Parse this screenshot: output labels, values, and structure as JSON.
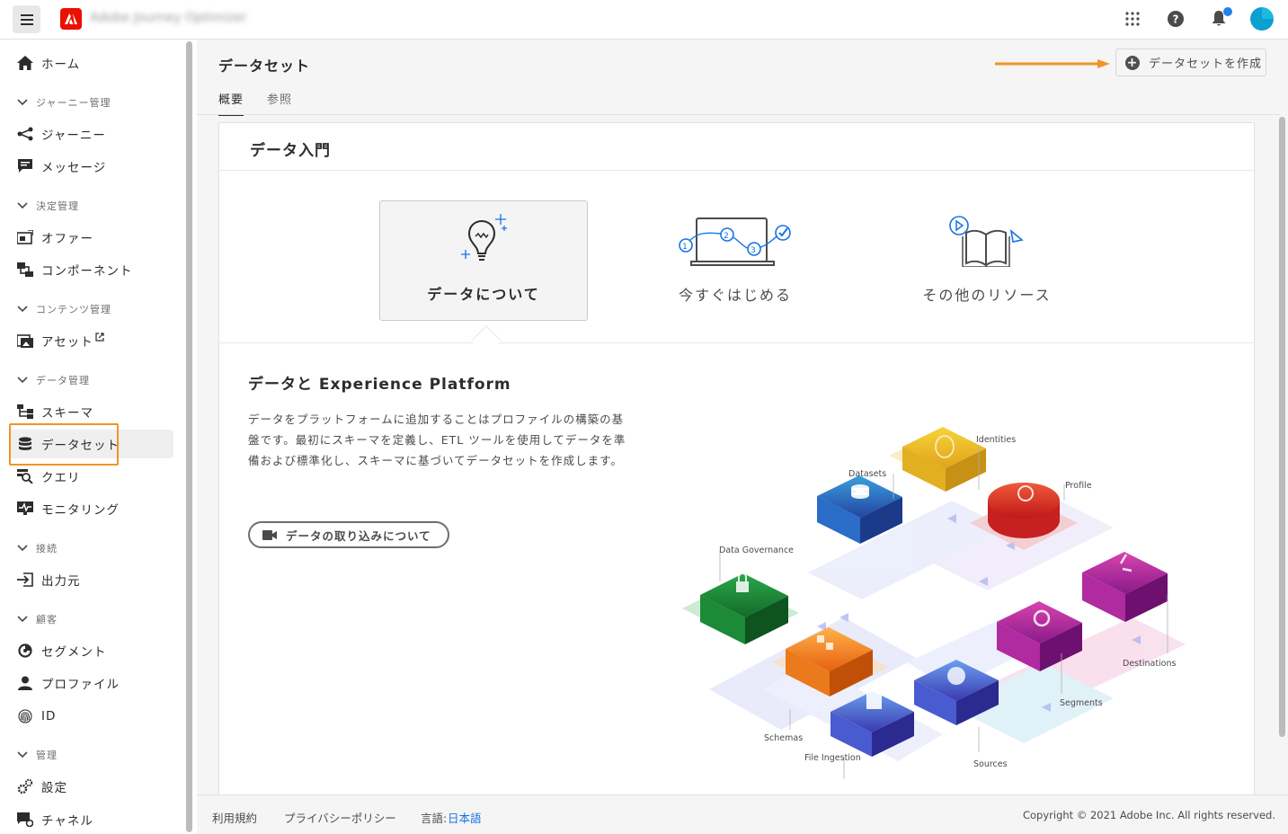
{
  "topbar": {
    "app_title": "Adobe Journey Optimizer"
  },
  "sidebar": {
    "home": "ホーム",
    "sections": [
      {
        "label": "ジャーニー管理"
      },
      {
        "label": "決定管理"
      },
      {
        "label": "コンテンツ管理"
      },
      {
        "label": "データ管理"
      },
      {
        "label": "接続"
      },
      {
        "label": "顧客"
      },
      {
        "label": "管理"
      }
    ],
    "items": {
      "journeys": "ジャーニー",
      "messages": "メッセージ",
      "offers": "オファー",
      "components": "コンポーネント",
      "assets": "アセット",
      "schemas": "スキーマ",
      "datasets": "データセット",
      "queries": "クエリ",
      "monitoring": "モニタリング",
      "sources": "出力元",
      "segments": "セグメント",
      "profiles": "プロファイル",
      "identities": "ID",
      "settings": "設定",
      "channels": "チャネル"
    }
  },
  "header": {
    "title": "データセット",
    "create_button": "データセットを作成",
    "tabs": [
      "概要",
      "参照"
    ]
  },
  "card": {
    "title": "データ入門",
    "options": [
      "データについて",
      "今すぐはじめる",
      "その他のリソース"
    ],
    "section_title": "データと Experience Platform",
    "section_body": "データをプラットフォームに追加することはプロファイルの構築の基盤です。最初にスキーマを定義し、ETL ツールを使用してデータを準備および標準化し、スキーマに基づいてデータセットを作成します。",
    "video_button": "データの取り込みについて"
  },
  "illustration_labels": {
    "identities": "Identities",
    "datasets": "Datasets",
    "profile": "Profile",
    "data_governance": "Data Governance",
    "destinations": "Destinations",
    "segments": "Segments",
    "schemas": "Schemas",
    "sources": "Sources",
    "file_ingestion": "File Ingestion"
  },
  "footer": {
    "terms": "利用規約",
    "privacy": "プライバシーポリシー",
    "lang_label": "言語:",
    "lang_value": "日本語",
    "copyright": "Copyright © 2021 Adobe Inc. All rights reserved."
  },
  "colors": {
    "accent_orange": "#f29423",
    "adobe_red": "#eb1000",
    "link_blue": "#1473e6"
  }
}
